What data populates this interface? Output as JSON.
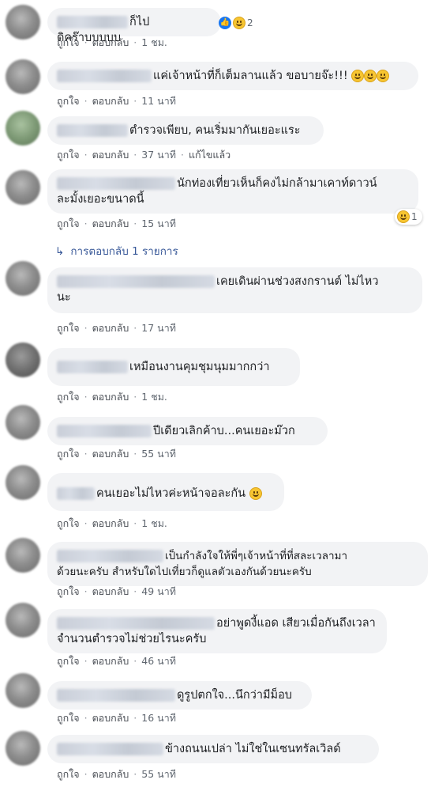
{
  "actions": {
    "like": "ถูกใจ",
    "reply": "ตอบกลับ",
    "edited": "แก้ไขแล้ว",
    "separator": "·"
  },
  "comments": [
    {
      "text": "ก็ไปดิคร๊าบบบบบ",
      "time": "1 ชม.",
      "reaction_count": "2"
    },
    {
      "text": "แค่เจ้าหน้าที่ก็เต็มลานแล้ว ขอบายจ๊ะ!!!",
      "time": "11 นาที"
    },
    {
      "text": "ตำรวจเพียบ, คนเริ่มมากันเยอะแระ",
      "time": "37 นาที"
    },
    {
      "text_line1": "นักท่องเที่ยวเห็นก็คงไม่กล้ามาเคาท์ดาวน์",
      "text_line2": "ละมั้งเยอะขนาดนี้",
      "time": "15 นาที",
      "reaction_count": "1",
      "replies_label": "การตอบกลับ 1 รายการ"
    },
    {
      "text_line1": "เคยเดินผ่านช่วงสงกรานต์ ไม่ไหว",
      "text_line2": "นะ",
      "time": "17 นาที"
    },
    {
      "text": "เหมือนงานคุมชุมนุมมากกว่า",
      "time": "1 ชม."
    },
    {
      "text": "ปีเดียวเลิกค้าบ...คนเยอะม๊วก",
      "time": "55 นาที"
    },
    {
      "text": "คนเยอะไม่ไหวค่ะหน้าจอละกัน",
      "time": "1 ชม."
    },
    {
      "text_line1": "เป็นกำลังใจให้พี่ๆเจ้าหน้าที่ที่สละเวลามา",
      "text_line2": "ด้วยนะครับ สำหรับใดไปเที่ยวก็ดูแลตัวเองกันด้วยนะครับ",
      "time": "49 นาที"
    },
    {
      "text_line1": "อย่าพูดงี้แอด เสียวเมื่อกันถึงเวลา",
      "text_line2": "จำนวนตำรวจไม่ช่วยไรนะครับ",
      "time": "46 นาที"
    },
    {
      "text": "ดูรูปตกใจ...นึกว่ามีม็อบ",
      "time": "16 นาที"
    },
    {
      "text": "ข้างถนนเปล่า ไม่ใช่ในเซนทรัลเวิลด์",
      "time": "55 นาที"
    }
  ]
}
